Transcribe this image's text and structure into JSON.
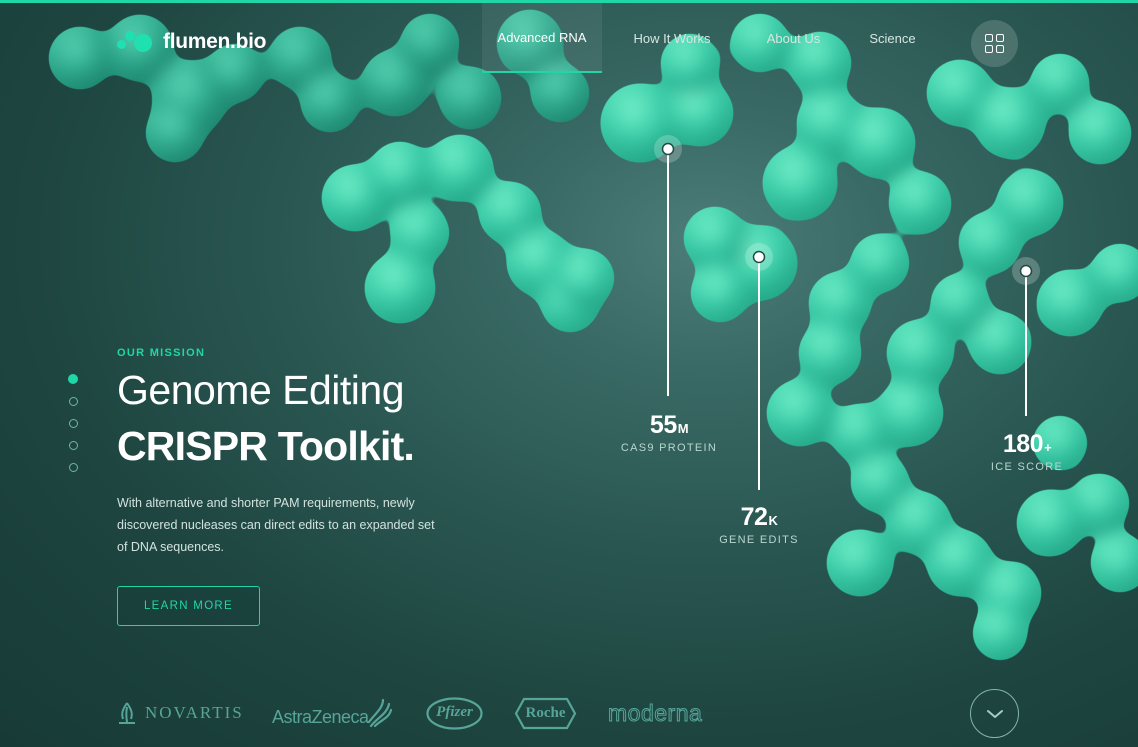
{
  "brand": {
    "name": "flumen.bio",
    "accent_color": "#20d6a7",
    "background_color": "#1f4a45"
  },
  "nav": {
    "items": [
      {
        "label": "Advanced RNA",
        "active": true
      },
      {
        "label": "How It Works",
        "active": false
      },
      {
        "label": "About Us",
        "active": false
      },
      {
        "label": "Science",
        "active": false
      }
    ],
    "menu_icon": "grid-icon"
  },
  "hero": {
    "eyebrow": "OUR MISSION",
    "title_line1": "Genome Editing",
    "title_line2": "CRISPR Toolkit.",
    "description": "With alternative and shorter PAM requirements, newly discovered nucleases can direct edits to an expanded set of DNA sequences.",
    "cta_label": "LEARN MORE",
    "slides_total": 5,
    "slide_active": 1
  },
  "stats": [
    {
      "value": "55",
      "unit": "M",
      "label": "CAS9 PROTEIN"
    },
    {
      "value": "72",
      "unit": "K",
      "label": "GENE EDITS"
    },
    {
      "value": "180",
      "unit": "+",
      "label": "ICE SCORE"
    }
  ],
  "partners": [
    "NOVARTIS",
    "AstraZeneca",
    "Pfizer",
    "Roche",
    "moderna"
  ],
  "scroll_icon": "chevron-down-icon"
}
